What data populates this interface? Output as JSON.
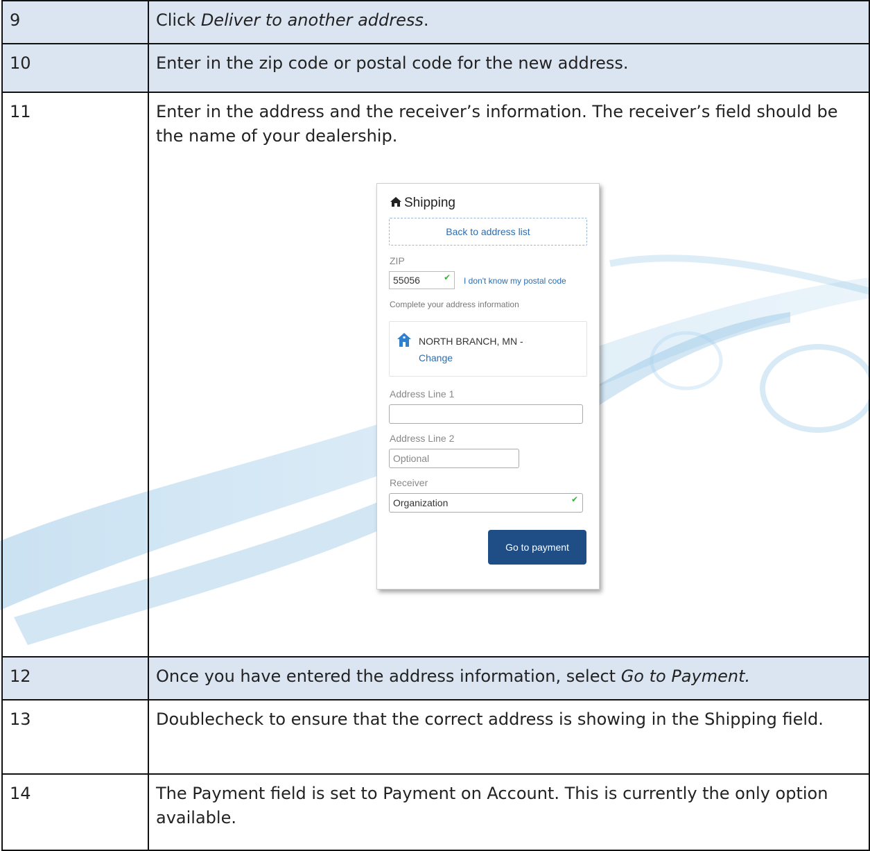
{
  "steps": [
    {
      "num": "9",
      "text_before": "Click ",
      "text_em": "Deliver to another address",
      "text_after": "."
    },
    {
      "num": "10",
      "text": "Enter in the zip code or postal code for the new address."
    },
    {
      "num": "11",
      "text": "Enter in the address and the receiver’s information. The receiver’s field should be the name of your dealership."
    },
    {
      "num": "12",
      "text_before": "Once you have entered the address information, select ",
      "text_em": "Go to Payment."
    },
    {
      "num": "13",
      "text": "Doublecheck to ensure that the correct address is showing in the Shipping field."
    },
    {
      "num": "14",
      "text": "The Payment field is set to Payment on Account. This is currently the only option available."
    }
  ],
  "shipping_panel": {
    "title": "Shipping",
    "title_icon": "home-icon",
    "back_link": "Back to address list",
    "zip_label": "ZIP",
    "zip_value": "55056",
    "zip_help_link": "I don't know my postal code",
    "hint": "Complete your address information",
    "city_line": "NORTH BRANCH, MN -",
    "change_link": "Change",
    "address1_label": "Address Line 1",
    "address1_value": "",
    "address2_label": "Address Line 2",
    "address2_placeholder": "Optional",
    "receiver_label": "Receiver",
    "receiver_value": "Organization",
    "submit_button": "Go to payment",
    "colors": {
      "link": "#2a6db1",
      "button": "#1f4e86",
      "check": "#3ab03a"
    }
  },
  "colors": {
    "header_row": "#dbe5f1",
    "border": "#111111"
  }
}
